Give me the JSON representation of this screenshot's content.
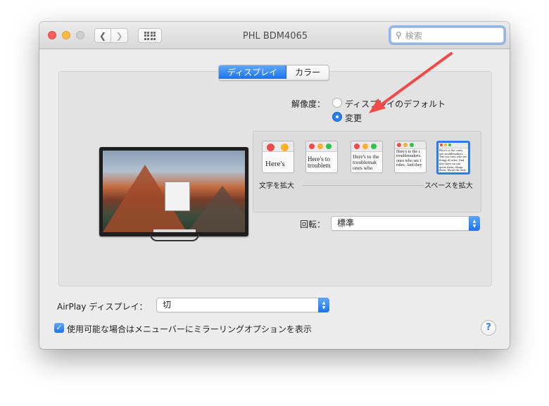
{
  "window": {
    "title": "PHL BDM4065",
    "search_placeholder": "検索"
  },
  "tabs": [
    {
      "label": "ディスプレイ",
      "active": true
    },
    {
      "label": "カラー",
      "active": false
    }
  ],
  "resolution": {
    "label": "解像度：",
    "options": [
      {
        "label": "ディスプレイのデフォルト",
        "selected": false
      },
      {
        "label": "変更",
        "selected": true
      }
    ]
  },
  "scaling": {
    "thumbnails": [
      {
        "text": "Here's"
      },
      {
        "text": "Here's to troublem"
      },
      {
        "text": "Here's to the troublemak ones who"
      },
      {
        "text": "Here's to the c troublemakers. ones who see t rules. And they"
      },
      {
        "text": "Here's to the crazy one troublemakers. The rou ones who see things di rules. And they have no can quote them, disagr them. About the only thi Because they change t"
      }
    ],
    "selected_index": 4,
    "left_label": "文字を拡大",
    "right_label": "スペースを拡大"
  },
  "rotation": {
    "label": "回転：",
    "value": "標準"
  },
  "airplay": {
    "label": "AirPlay ディスプレイ：",
    "value": "切"
  },
  "mirroring_checkbox": {
    "label": "使用可能な場合はメニューバーにミラーリングオプションを表示",
    "checked": true
  },
  "help_symbol": "?",
  "colors": {
    "accent": "#2a7df1",
    "annotation_arrow": "#f04a4a"
  }
}
